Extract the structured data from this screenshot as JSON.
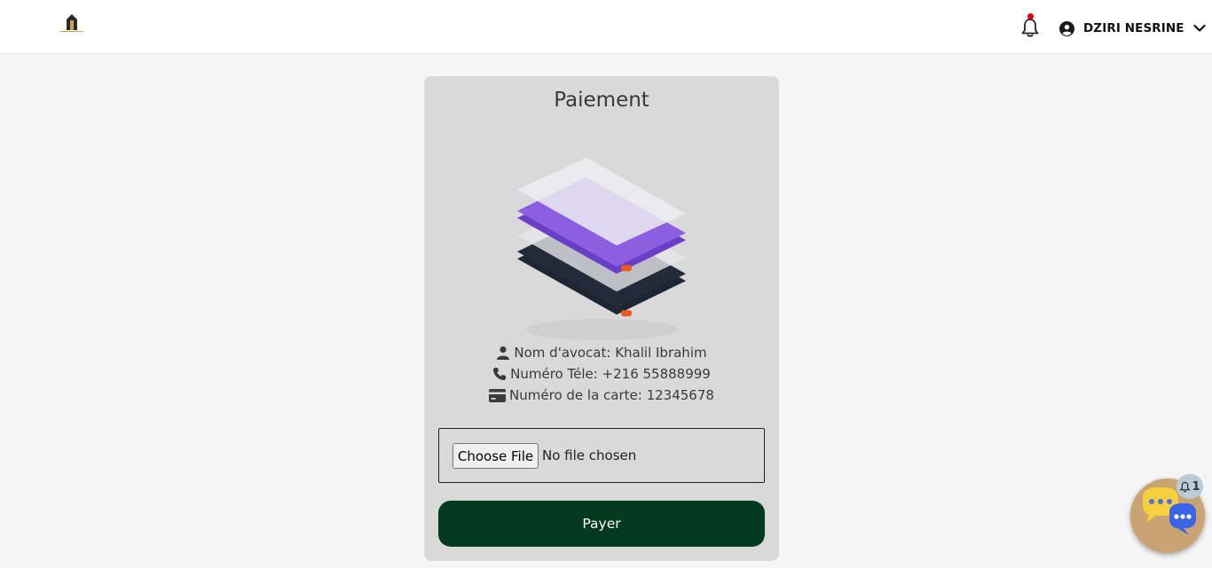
{
  "header": {
    "user_name": "DZIRI NESRINE"
  },
  "payment": {
    "title": "Paiement",
    "lawyer_name": "Nom d'avocat: Khalil Ibrahim",
    "phone": "Numéro Téle: +216 55888999",
    "card_number": "Numéro de la carte: 12345678",
    "file_button": "Choose File",
    "file_status": "No file chosen",
    "pay_button": "Payer"
  },
  "chat": {
    "badge_count": "1"
  },
  "colors": {
    "pay_button": "#043b20",
    "card_bg": "#d9d9d9",
    "chat_fab": "#c9a472"
  },
  "icons": [
    "logo",
    "bell-icon",
    "user-circle-icon",
    "chevron-down-icon",
    "user-icon",
    "phone-icon",
    "credit-card-icon",
    "chat-icon"
  ]
}
